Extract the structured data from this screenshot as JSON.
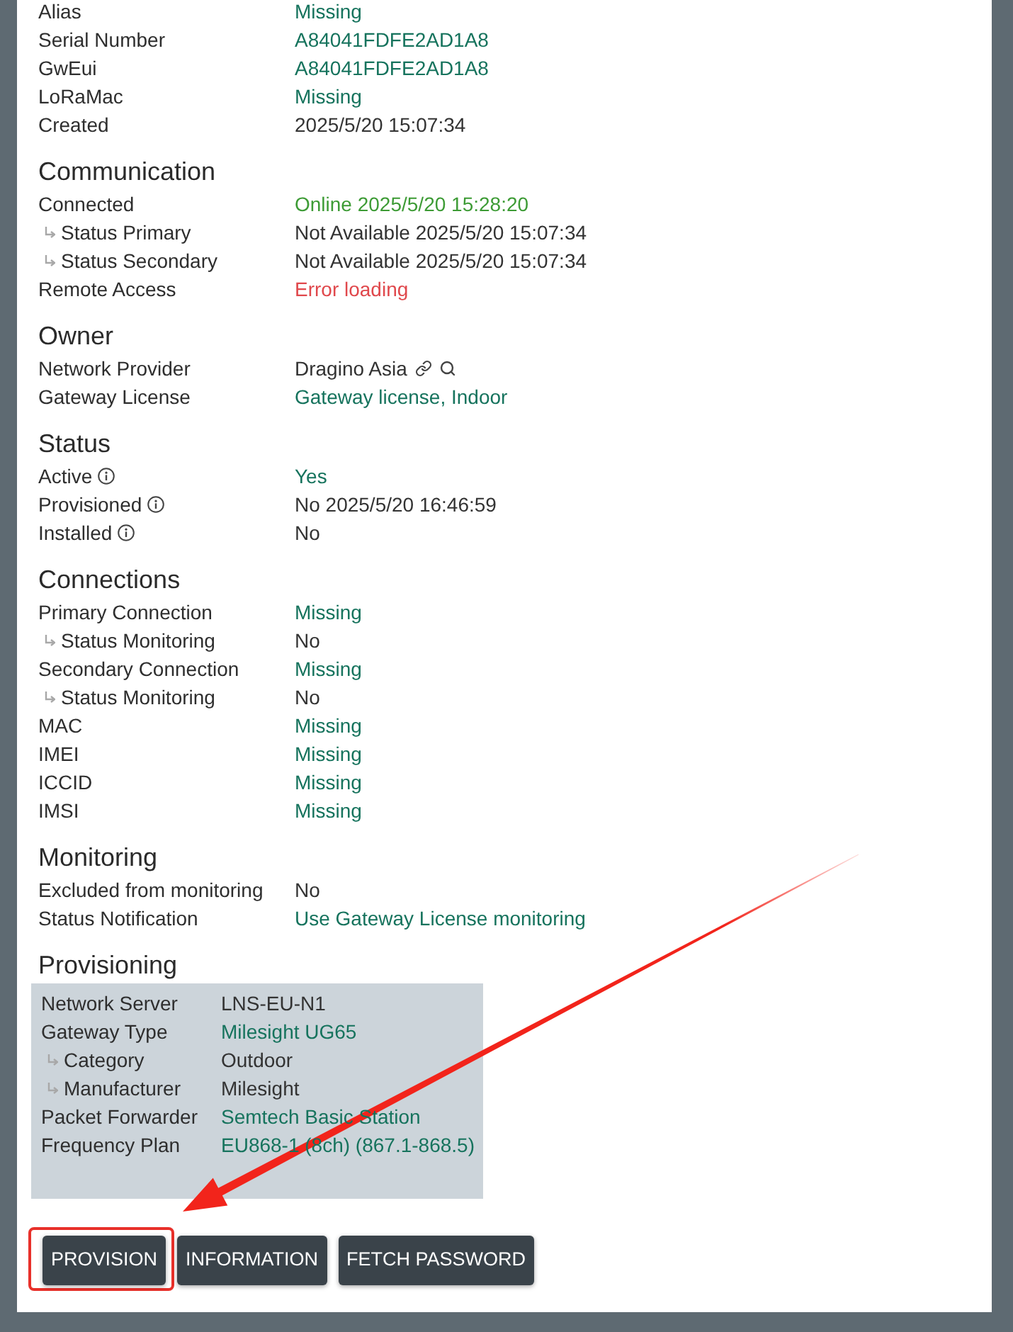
{
  "sections": [
    {
      "rows": [
        {
          "label": "Alias",
          "value": "Missing",
          "color": "#16735d"
        },
        {
          "label": "Serial Number",
          "value": "A84041FDFE2AD1A8",
          "color": "#16735d"
        },
        {
          "label": "GwEui",
          "value": "A84041FDFE2AD1A8",
          "color": "#16735d"
        },
        {
          "label": "LoRaMac",
          "value": "Missing",
          "color": "#16735d"
        },
        {
          "label": "Created",
          "value": "2025/5/20 15:07:34"
        }
      ]
    },
    {
      "title": "Communication",
      "rows": [
        {
          "label": "Connected",
          "value": "Online 2025/5/20 15:28:20",
          "color": "#3d9b35",
          "children": [
            {
              "label": "Status Primary",
              "value": "Not Available 2025/5/20 15:07:34"
            },
            {
              "label": "Status Secondary",
              "value": "Not Available 2025/5/20 15:07:34"
            }
          ]
        },
        {
          "label": "Remote Access",
          "value": "Error loading",
          "color": "#e0484c"
        }
      ]
    },
    {
      "title": "Owner",
      "rows": [
        {
          "label": "Network Provider",
          "value": "Dragino Asia",
          "linked": true
        },
        {
          "label": "Gateway License",
          "value": "Gateway license, Indoor",
          "color": "#16735d"
        }
      ]
    },
    {
      "title": "Status",
      "rows": [
        {
          "label": "Active",
          "value": "Yes",
          "color": "#16735d",
          "info": true
        },
        {
          "label": "Provisioned",
          "value": "No 2025/5/20 16:46:59",
          "info": true
        },
        {
          "label": "Installed",
          "value": "No",
          "info": true
        }
      ]
    },
    {
      "title": "Connections",
      "rows": [
        {
          "label": "Primary Connection",
          "value": "Missing",
          "color": "#16735d",
          "children": [
            {
              "label": "Status Monitoring",
              "value": "No"
            }
          ]
        },
        {
          "label": "Secondary Connection",
          "value": "Missing",
          "color": "#16735d",
          "children": [
            {
              "label": "Status Monitoring",
              "value": "No"
            }
          ]
        },
        {
          "label": "MAC",
          "value": "Missing",
          "color": "#16735d"
        },
        {
          "label": "IMEI",
          "value": "Missing",
          "color": "#16735d"
        },
        {
          "label": "ICCID",
          "value": "Missing",
          "color": "#16735d"
        },
        {
          "label": "IMSI",
          "value": "Missing",
          "color": "#16735d"
        }
      ]
    },
    {
      "title": "Monitoring",
      "rows": [
        {
          "label": "Excluded from monitoring",
          "value": "No"
        },
        {
          "label": "Status Notification",
          "value": "Use Gateway License monitoring",
          "color": "#16735d"
        }
      ]
    },
    {
      "title": "Provisioning",
      "boxed": true,
      "rows": [
        {
          "label": "Network Server",
          "value": "LNS-EU-N1"
        },
        {
          "label": "Gateway Type",
          "value": "Milesight UG65",
          "color": "#16735d",
          "children": [
            {
              "label": "Category",
              "value": "Outdoor"
            },
            {
              "label": "Manufacturer",
              "value": "Milesight"
            }
          ]
        },
        {
          "label": "Packet Forwarder",
          "value": "Semtech Basic Station",
          "color": "#16735d"
        },
        {
          "label": "Frequency Plan",
          "value": "EU868-1 (8ch) (867.1-868.5)",
          "color": "#16735d"
        }
      ]
    }
  ],
  "buttons": [
    {
      "label": "PROVISION",
      "highlighted": true
    },
    {
      "label": "INFORMATION",
      "highlighted": false
    },
    {
      "label": "FETCH PASSWORD",
      "highlighted": false
    }
  ]
}
